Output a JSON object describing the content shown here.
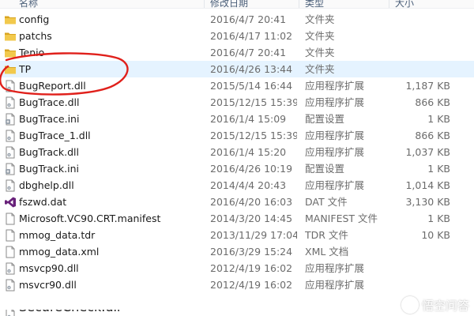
{
  "header": {
    "columns": [
      {
        "label": "名称"
      },
      {
        "label": "修改日期"
      },
      {
        "label": "类型"
      },
      {
        "label": "大小"
      }
    ]
  },
  "files": [
    {
      "name": "config",
      "date": "2016/4/7 20:41",
      "type": "文件夹",
      "size": "",
      "icon": "folder-icon",
      "kind": "folder"
    },
    {
      "name": "patchs",
      "date": "2016/4/17 11:02",
      "type": "文件夹",
      "size": "",
      "icon": "folder-icon",
      "kind": "folder"
    },
    {
      "name": "Tenio",
      "date": "2016/4/7 20:41",
      "type": "文件夹",
      "size": "",
      "icon": "folder-icon",
      "kind": "folder"
    },
    {
      "name": "TP",
      "date": "2016/4/26 13:44",
      "type": "文件夹",
      "size": "",
      "icon": "folder-icon",
      "kind": "folder",
      "state": "hover"
    },
    {
      "name": "BugReport.dll",
      "date": "2015/5/14 16:44",
      "type": "应用程序扩展",
      "size": "1,187 KB",
      "icon": "dll-file-icon",
      "kind": "dll"
    },
    {
      "name": "BugTrace.dll",
      "date": "2015/12/15 15:39",
      "type": "应用程序扩展",
      "size": "866 KB",
      "icon": "dll-file-icon",
      "kind": "dll"
    },
    {
      "name": "BugTrace.ini",
      "date": "2016/1/4 15:09",
      "type": "配置设置",
      "size": "1 KB",
      "icon": "ini-file-icon",
      "kind": "ini"
    },
    {
      "name": "BugTrace_1.dll",
      "date": "2015/12/15 15:39",
      "type": "应用程序扩展",
      "size": "866 KB",
      "icon": "dll-file-icon",
      "kind": "dll"
    },
    {
      "name": "BugTrack.dll",
      "date": "2016/1/4 15:20",
      "type": "应用程序扩展",
      "size": "1,037 KB",
      "icon": "dll-file-icon",
      "kind": "dll"
    },
    {
      "name": "BugTrack.ini",
      "date": "2016/4/26 10:19",
      "type": "配置设置",
      "size": "1 KB",
      "icon": "ini-file-icon",
      "kind": "ini"
    },
    {
      "name": "dbghelp.dll",
      "date": "2014/4/4 20:43",
      "type": "应用程序扩展",
      "size": "1,014 KB",
      "icon": "dll-file-icon",
      "kind": "dll"
    },
    {
      "name": "fszwd.dat",
      "date": "2016/4/20 16:03",
      "type": "DAT 文件",
      "size": "3,130 KB",
      "icon": "visual-studio-icon",
      "kind": "vs"
    },
    {
      "name": "Microsoft.VC90.CRT.manifest",
      "date": "2014/3/20 14:45",
      "type": "MANIFEST 文件",
      "size": "1 KB",
      "icon": "generic-file-icon",
      "kind": "file"
    },
    {
      "name": "mmog_data.tdr",
      "date": "2013/11/29 17:04",
      "type": "TDR 文件",
      "size": "10 KB",
      "icon": "generic-file-icon",
      "kind": "file"
    },
    {
      "name": "mmog_data.xml",
      "date": "2016/3/29 15:24",
      "type": "XML 文档",
      "size": "",
      "icon": "generic-file-icon",
      "kind": "file"
    },
    {
      "name": "msvcp90.dll",
      "date": "2012/4/19 16:02",
      "type": "应用程序扩展",
      "size": "",
      "icon": "dll-file-icon",
      "kind": "dll"
    },
    {
      "name": "msvcr90.dll",
      "date": "2012/4/19 16:02",
      "type": "应用程序扩展",
      "size": "",
      "icon": "dll-file-icon",
      "kind": "dll"
    }
  ],
  "partial_row": {
    "name": "SecureCheck.dll",
    "icon": "dll-file-icon"
  },
  "watermark": {
    "text": "悟空问答",
    "icon": "wukong-logo-icon"
  },
  "colors": {
    "folder_yellow": "#f2c94c",
    "folder_dark": "#d9a521",
    "annotation_red": "#e0201b",
    "hover_blue": "#e5f3ff",
    "text_secondary": "#6b6b6b",
    "vs_purple": "#68217a"
  }
}
